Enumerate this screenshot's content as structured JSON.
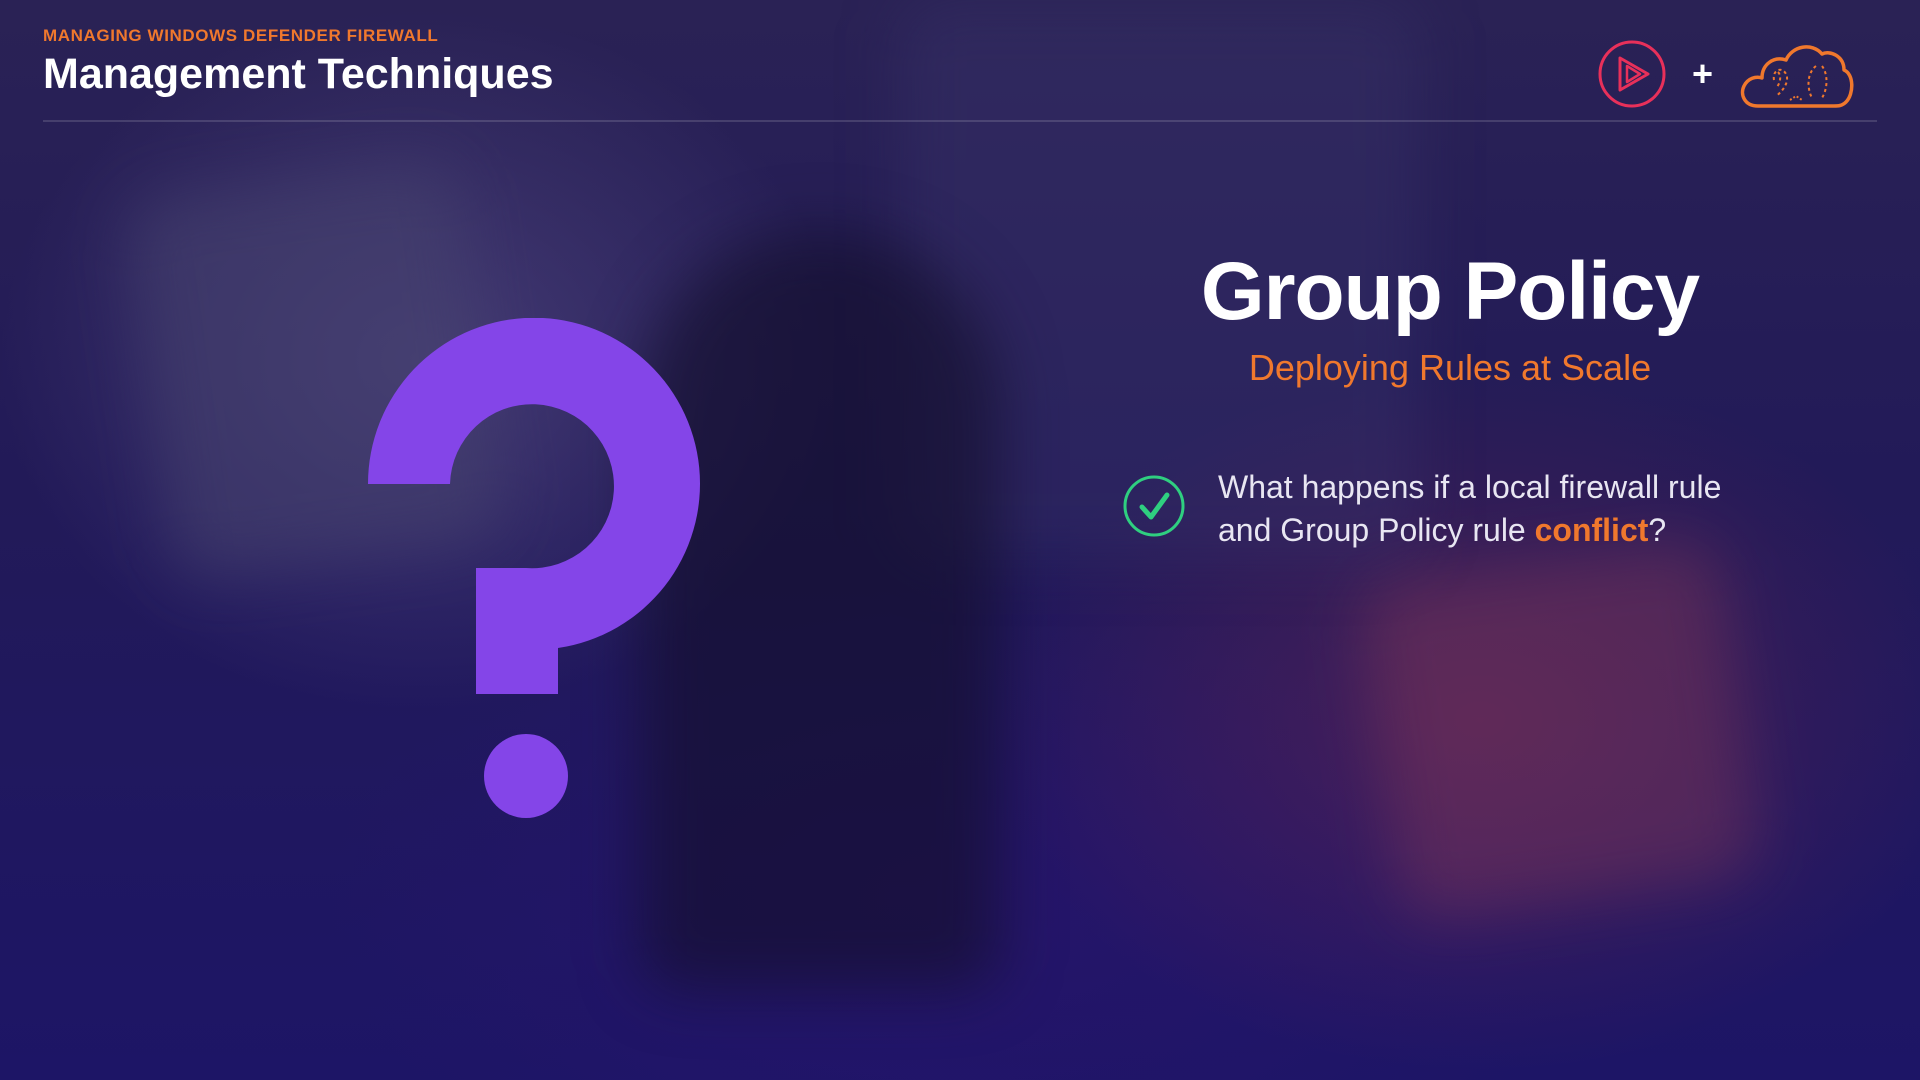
{
  "header": {
    "eyebrow": "MANAGING WINDOWS DEFENDER FIREWALL",
    "title": "Management Techniques"
  },
  "logos": {
    "left_icon": "play-logo-icon",
    "separator": "+",
    "right_icon": "cloud-logo-icon"
  },
  "graphic": {
    "icon": "question-mark-icon",
    "color": "#8445e8"
  },
  "slide": {
    "title": "Group Policy",
    "subtitle": "Deploying Rules at Scale",
    "bullet": {
      "icon": "checkmark-circle-icon",
      "text_line1": "What happens if a local firewall rule",
      "text_before": "and Group Policy rule ",
      "emphasis": "conflict",
      "text_after": "?"
    }
  },
  "colors": {
    "accent_orange": "#f0782d",
    "accent_purple": "#8445e8",
    "check_green": "#2fcf80",
    "logo_red": "#e8305a",
    "background": "#221a58"
  }
}
